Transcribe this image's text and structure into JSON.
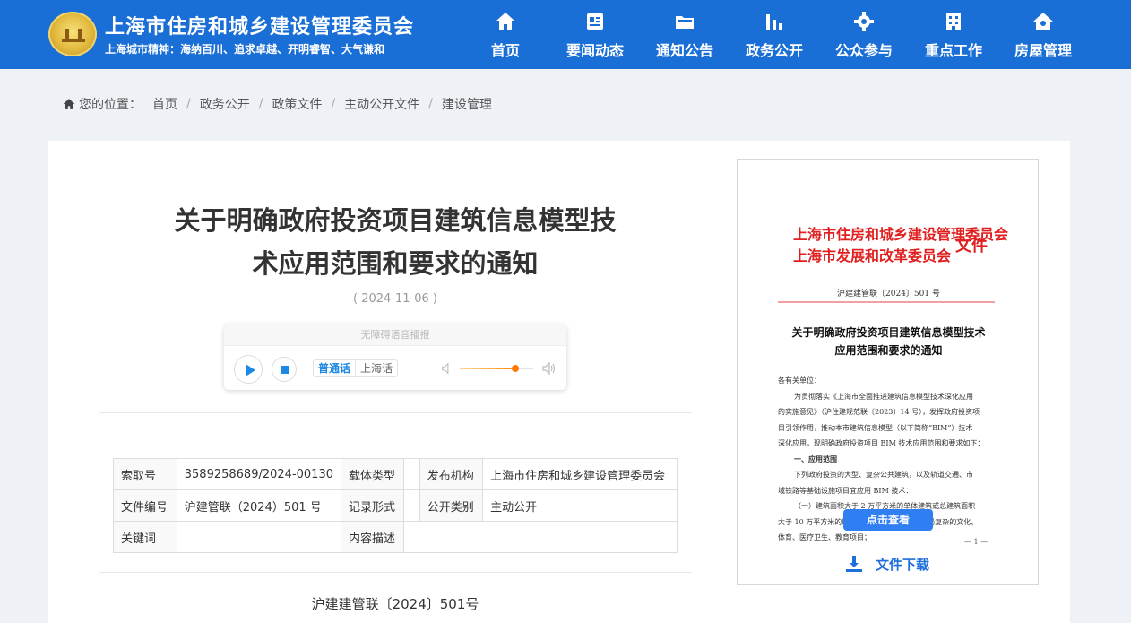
{
  "header": {
    "title": "上海市住房和城乡建设管理委员会",
    "slogan": "上海城市精神：海纳百川、追求卓越、开明睿智、大气谦和",
    "nav": [
      {
        "label": "首页",
        "icon": "home-icon"
      },
      {
        "label": "要闻动态",
        "icon": "news-icon"
      },
      {
        "label": "通知公告",
        "icon": "folder-icon"
      },
      {
        "label": "政务公开",
        "icon": "chart-icon"
      },
      {
        "label": "公众参与",
        "icon": "gear-icon"
      },
      {
        "label": "重点工作",
        "icon": "building-icon"
      },
      {
        "label": "房屋管理",
        "icon": "house-icon"
      }
    ]
  },
  "breadcrumb": {
    "prefix": "您的位置：",
    "items": [
      "首页",
      "政务公开",
      "政策文件",
      "主动公开文件",
      "建设管理"
    ]
  },
  "article": {
    "title_line1": "关于明确政府投资项目建筑信息模型技",
    "title_line2": "术应用范围和要求的通知",
    "date": "( 2024-11-06 )"
  },
  "player": {
    "title": "无障碍语音播报",
    "lang_mandarin": "普通话",
    "lang_shanghai": "上海话",
    "volume": 0.75
  },
  "info": {
    "index_label": "索取号",
    "index_value": "3589258689/2024-00130",
    "carrier_label": "载体类型",
    "carrier_value": "",
    "publisher_label": "发布机构",
    "publisher_value": "上海市住房和城乡建设管理委员会",
    "docno_label": "文件编号",
    "docno_value": "沪建管联（2024）501 号",
    "record_label": "记录形式",
    "record_value": "",
    "category_label": "公开类别",
    "category_value": "主动公开",
    "keyword_label": "关键词",
    "keyword_value": "",
    "desc_label": "内容描述",
    "desc_value": ""
  },
  "doc_number_text": "沪建建管联〔2024〕501号",
  "preview": {
    "issuer_line1": "上海市住房和城乡建设管理委员会",
    "issuer_line2": "上海市发展和改革委员会",
    "issuer_suffix": "文件",
    "doc_no": "沪建建管联〔2024〕501 号",
    "title_line1": "关于明确政府投资项目建筑信息模型技术",
    "title_line2": "应用范围和要求的通知",
    "body": [
      "各有关单位：",
      "为贯彻落实《上海市全面推进建筑信息模型技术深化应用",
      "的实施意见》（沪住建规范联〔2023〕14 号），发挥政府投资项",
      "目引领作用，推动本市建筑信息模型（以下简称“BIM”）技术",
      "深化应用，现明确政府投资项目 BIM 技术应用范围和要求如下：",
      "一、应用范围",
      "下列政府投资的大型、复杂公共建筑，以及轨道交通、市",
      "域铁路等基础设施项目宜应用 BIM 技术：",
      "（一）建筑面积大于 2 万平方米的单体建筑或总建筑面积",
      "大于 10 万平方米的居住区，或者造型和内部布局复杂的文化、",
      "体育、医疗卫生、教育项目；"
    ],
    "page": "— 1 —",
    "view_button": "点击查看",
    "download_label": "文件下载"
  },
  "colors": {
    "header_bg": "#1a6fd6",
    "accent": "#1e88e5",
    "red_heading": "#e02020"
  }
}
